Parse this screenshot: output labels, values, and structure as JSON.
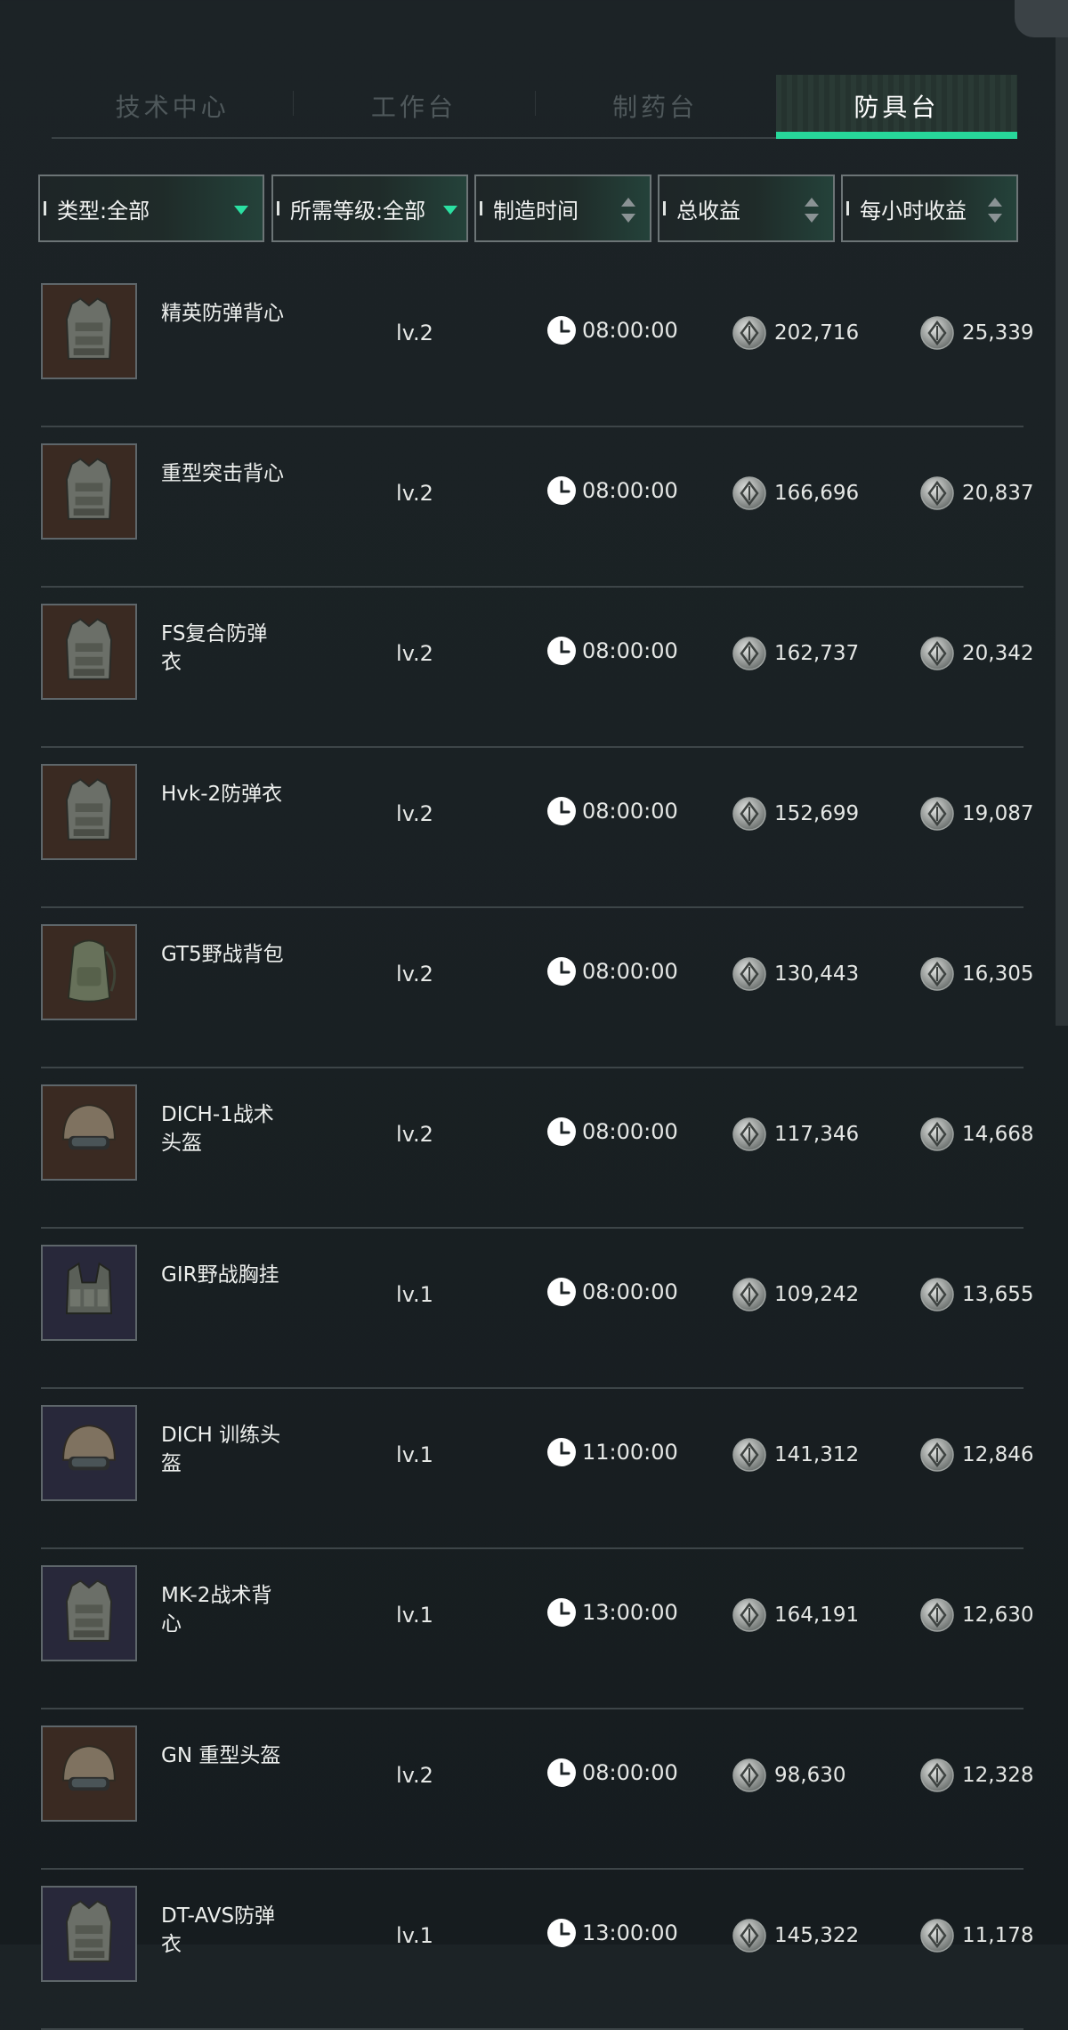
{
  "tabs": [
    {
      "label": "技术中心",
      "active": false
    },
    {
      "label": "工作台",
      "active": false
    },
    {
      "label": "制药台",
      "active": false
    },
    {
      "label": "防具台",
      "active": true
    }
  ],
  "filters": {
    "type": "类型:全部",
    "level": "所需等级:全部",
    "craft_time": "制造时间",
    "total_profit": "总收益",
    "hourly_profit": "每小时收益"
  },
  "colors": {
    "accent": "#27d79a",
    "background": "#1c2326"
  },
  "items": [
    {
      "name": "精英防弹背心",
      "level": "lv.2",
      "time": "08:00:00",
      "total": "202,716",
      "hourly": "25,339",
      "icon": "vest-icon",
      "bg": "#3a2a22"
    },
    {
      "name": "重型突击背心",
      "level": "lv.2",
      "time": "08:00:00",
      "total": "166,696",
      "hourly": "20,837",
      "icon": "vest-icon",
      "bg": "#3a2a22"
    },
    {
      "name": "FS复合防弹衣",
      "level": "lv.2",
      "time": "08:00:00",
      "total": "162,737",
      "hourly": "20,342",
      "icon": "vest-icon",
      "bg": "#3a2a22"
    },
    {
      "name": "Hvk-2防弹衣",
      "level": "lv.2",
      "time": "08:00:00",
      "total": "152,699",
      "hourly": "19,087",
      "icon": "vest-icon",
      "bg": "#3a2a22"
    },
    {
      "name": "GT5野战背包",
      "level": "lv.2",
      "time": "08:00:00",
      "total": "130,443",
      "hourly": "16,305",
      "icon": "backpack-icon",
      "bg": "#3a2a22"
    },
    {
      "name": "DICH-1战术头盔",
      "level": "lv.2",
      "time": "08:00:00",
      "total": "117,346",
      "hourly": "14,668",
      "icon": "helmet-icon",
      "bg": "#3a2a22"
    },
    {
      "name": "GIR野战胸挂",
      "level": "lv.1",
      "time": "08:00:00",
      "total": "109,242",
      "hourly": "13,655",
      "icon": "chest-rig-icon",
      "bg": "#28283a"
    },
    {
      "name": "DICH 训练头盔",
      "level": "lv.1",
      "time": "11:00:00",
      "total": "141,312",
      "hourly": "12,846",
      "icon": "helmet-icon",
      "bg": "#28283a"
    },
    {
      "name": "MK-2战术背心",
      "level": "lv.1",
      "time": "13:00:00",
      "total": "164,191",
      "hourly": "12,630",
      "icon": "vest-icon",
      "bg": "#28283a"
    },
    {
      "name": "GN 重型头盔",
      "level": "lv.2",
      "time": "08:00:00",
      "total": "98,630",
      "hourly": "12,328",
      "icon": "helmet-icon",
      "bg": "#3a2a22"
    },
    {
      "name": "DT-AVS防弹衣",
      "level": "lv.1",
      "time": "13:00:00",
      "total": "145,322",
      "hourly": "11,178",
      "icon": "vest-icon",
      "bg": "#28283a"
    }
  ]
}
